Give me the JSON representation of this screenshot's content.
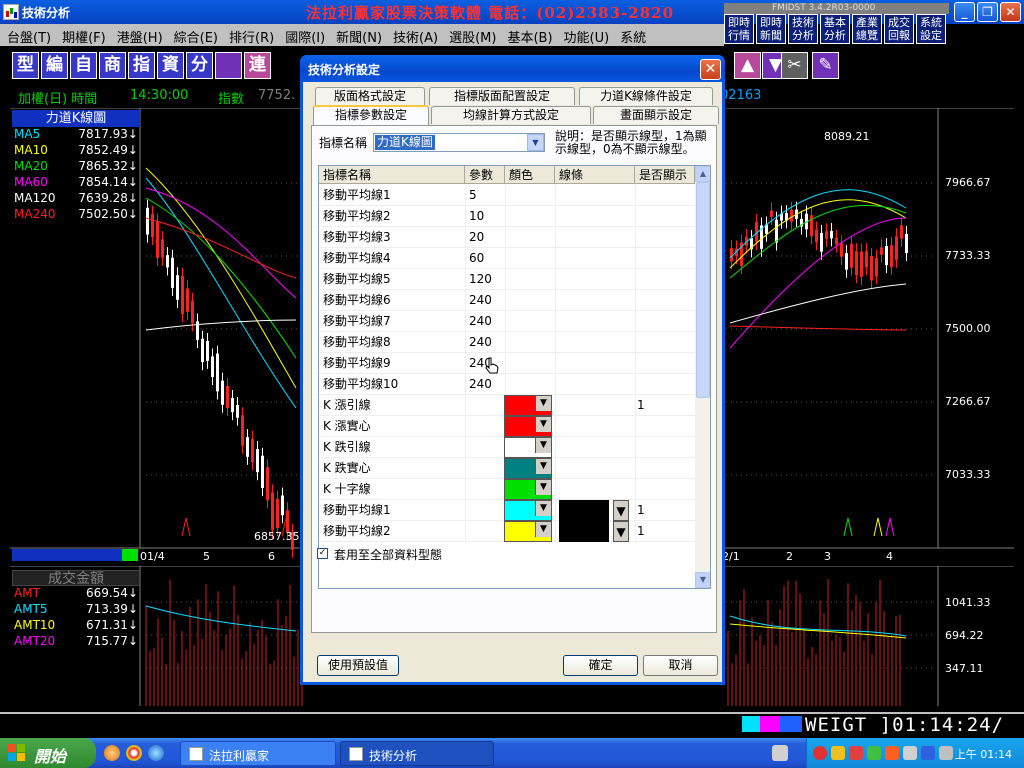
{
  "window": {
    "title": "技術分析",
    "ad": "法拉利贏家股票決策軟體  電話：(02)2383-2820",
    "version": "FMIDST 3.4.2R03-0000"
  },
  "menu": [
    "台盤(T)",
    "期權(F)",
    "港盤(H)",
    "綜合(E)",
    "排行(R)",
    "國際(I)",
    "新聞(N)",
    "技術(A)",
    "選股(M)",
    "基本(B)",
    "功能(U)",
    "系統"
  ],
  "quick_buttons": [
    "即時行情",
    "即時新聞",
    "技術分析",
    "基本分析",
    "產業總覽",
    "成交回報",
    "系統設定"
  ],
  "toolbar": [
    "型",
    "編",
    "自",
    "商",
    "指",
    "資",
    "分",
    "",
    "連"
  ],
  "info": {
    "label": "加權(日) 時間",
    "time": "14:30:00",
    "index_label": "指數",
    "index_value": "7752.",
    "right": "02163"
  },
  "chart": {
    "panel_title": "力道K線圖",
    "ma": [
      {
        "name": "MA5",
        "value": "7817.93↓",
        "color": "#00e0ff"
      },
      {
        "name": "MA10",
        "value": "7852.49↓",
        "color": "#ffff00"
      },
      {
        "name": "MA20",
        "value": "7865.32↓",
        "color": "#00e000"
      },
      {
        "name": "MA60",
        "value": "7854.14↓",
        "color": "#ff00ff"
      },
      {
        "name": "MA120",
        "value": "7639.28↓",
        "color": "#ffffff"
      },
      {
        "name": "MA240",
        "value": "7502.50↓",
        "color": "#ff2020"
      }
    ],
    "y_labels": [
      "7966.67",
      "7733.33",
      "7500.00",
      "7266.67",
      "7033.33"
    ],
    "high_label": "8089.21",
    "low_label": "6857.35",
    "x_labels": [
      "01/4",
      "5",
      "6",
      "2/1",
      "2",
      "3",
      "4"
    ]
  },
  "volume": {
    "title": "成交金額",
    "rows": [
      {
        "name": "AMT",
        "value": "669.54↓",
        "color": "#ff2020"
      },
      {
        "name": "AMT5",
        "value": "713.39↓",
        "color": "#00e0ff"
      },
      {
        "name": "AMT10",
        "value": "671.31↓",
        "color": "#ffff00"
      },
      {
        "name": "AMT20",
        "value": "715.77↓",
        "color": "#ff00ff"
      }
    ],
    "y_labels": [
      "1041.33",
      "694.22",
      "347.11"
    ]
  },
  "status": {
    "weigt": "WEIGT  ]01:14:24/"
  },
  "dialog": {
    "title": "技術分析設定",
    "tabs_row1": [
      "版面格式設定",
      "指標版面配置設定",
      "力道K線條件設定"
    ],
    "tabs_row2": [
      "指標參數設定",
      "均線計算方式設定",
      "畫面顯示設定"
    ],
    "name_label": "指標名稱",
    "combo_value": "力道K線圖",
    "note": "說明：是否顯示線型，1為顯示線型，0為不顯示線型。",
    "columns": [
      "指標名稱",
      "參數",
      "顏色",
      "線條",
      "是否顯示"
    ],
    "rows": [
      {
        "name": "移動平均線1",
        "param": "5"
      },
      {
        "name": "移動平均線2",
        "param": "10"
      },
      {
        "name": "移動平均線3",
        "param": "20"
      },
      {
        "name": "移動平均線4",
        "param": "60"
      },
      {
        "name": "移動平均線5",
        "param": "120"
      },
      {
        "name": "移動平均線6",
        "param": "240"
      },
      {
        "name": "移動平均線7",
        "param": "240"
      },
      {
        "name": "移動平均線8",
        "param": "240"
      },
      {
        "name": "移動平均線9",
        "param": "240"
      },
      {
        "name": "移動平均線10",
        "param": "240"
      },
      {
        "name": "K 漲引線",
        "param": "",
        "color": "#ff0000",
        "show": "1"
      },
      {
        "name": "K 漲實心",
        "param": "",
        "color": "#ff0000"
      },
      {
        "name": "K 跌引線",
        "param": "",
        "color": "#ffffff"
      },
      {
        "name": "K 跌實心",
        "param": "",
        "color": "#008080"
      },
      {
        "name": "K 十字線",
        "param": "",
        "color": "#00e000"
      },
      {
        "name": "移動平均線1",
        "param": "",
        "color": "#00ffff",
        "line": true,
        "show": "1"
      },
      {
        "name": "移動平均線2",
        "param": "",
        "color": "#ffff00",
        "line": true,
        "show": "1"
      }
    ],
    "checkbox_label": "套用至全部資料型態",
    "btn_default": "使用預設值",
    "btn_ok": "確定",
    "btn_cancel": "取消"
  },
  "taskbar": {
    "start": "開始",
    "items": [
      "法拉利贏家",
      "技術分析"
    ],
    "clock": "上午 01:14"
  }
}
